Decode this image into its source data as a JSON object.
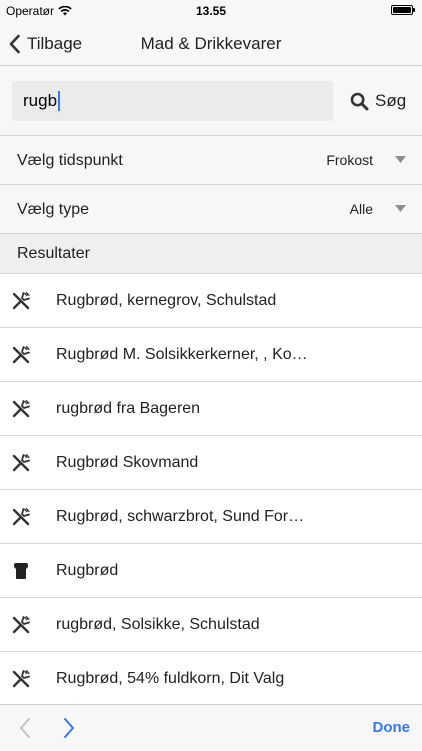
{
  "status_bar": {
    "carrier": "Operatør",
    "time": "13.55"
  },
  "nav": {
    "back_label": "Tilbage",
    "title": "Mad & Drikkevarer"
  },
  "search": {
    "value": "rugb",
    "button_label": "Søg"
  },
  "pickers": {
    "time": {
      "label": "Vælg tidspunkt",
      "value": "Frokost"
    },
    "type": {
      "label": "Vælg type",
      "value": "Alle"
    }
  },
  "results": {
    "header": "Resultater",
    "items": [
      {
        "label": "Rugbrød, kernegrov, Schulstad",
        "icon": "fork-knife-icon"
      },
      {
        "label": "Rugbrød M. Solsikkerkerner, , Ko…",
        "icon": "fork-knife-icon"
      },
      {
        "label": "rugbrød fra Bageren",
        "icon": "fork-knife-icon"
      },
      {
        "label": "Rugbrød Skovmand",
        "icon": "fork-knife-icon"
      },
      {
        "label": "Rugbrød, schwarzbrot, Sund For…",
        "icon": "fork-knife-icon"
      },
      {
        "label": "Rugbrød",
        "icon": "chef-hat-icon"
      },
      {
        "label": "rugbrød, Solsikke, Schulstad",
        "icon": "fork-knife-icon"
      },
      {
        "label": "Rugbrød, 54% fuldkorn, Dit Valg",
        "icon": "fork-knife-icon"
      }
    ]
  },
  "toolbar": {
    "done_label": "Done"
  },
  "colors": {
    "accent": "#3478f6",
    "background": "#f7f7f7",
    "section": "#efeff2"
  }
}
